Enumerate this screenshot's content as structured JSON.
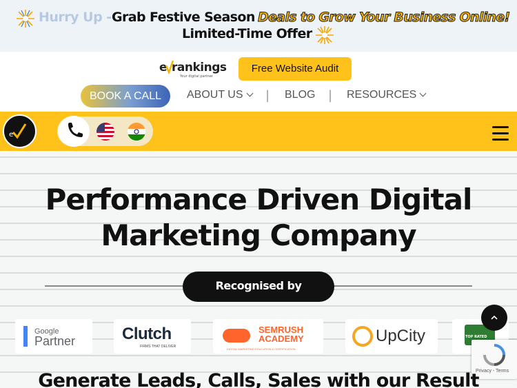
{
  "banner": {
    "hurry": "Hurry Up -",
    "grab": "Grab Festive Season",
    "deals": "Deals to Grow Your Business Online!",
    "offer": "Limited-Time Offer"
  },
  "header": {
    "logo_text": "rankings",
    "logo_e": "e",
    "logo_tagline": "Your digital partner",
    "audit_label": "Free Website Audit"
  },
  "nav": {
    "book": "BOOK A CALL",
    "about": "ABOUT US",
    "blog": "BLOG",
    "resources": "RESOURCES",
    "sep": "|"
  },
  "icons": {
    "phone": "phone-icon",
    "flag_us": "us-flag-icon",
    "flag_in": "india-flag-icon",
    "menu": "hamburger-menu-icon",
    "scroll_top": "chevron-up-icon"
  },
  "hero": {
    "title_line1": "Performance Driven Digital",
    "title_line2": "Marketing Company",
    "recognised": "Recognised by",
    "subhead": "Generate Leads, Calls, Sales with our Result"
  },
  "badges": {
    "google": "Google",
    "partner": "Partner",
    "clutch": "Clutch",
    "clutch_sub": "FIRMS THAT DELIVER",
    "semrush": "SEMRUSH",
    "academy": "ACADEMY",
    "semrush_sub": "DIGITAL MARKETING EDUCATION & CERTIFICATION",
    "upcity": "UpCity",
    "toprated": "TOP RATED"
  },
  "recaptcha": {
    "label": "Privacy - Terms"
  },
  "colors": {
    "brand_yellow": "#ffc21a",
    "dark": "#111111",
    "banner_bg": "#eef3f8"
  }
}
